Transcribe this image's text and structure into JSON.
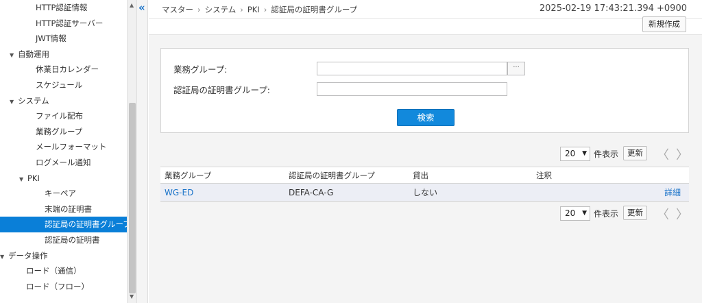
{
  "sidebar": {
    "items": [
      {
        "label": "HTTP認証情報",
        "indent": 52,
        "tri": "",
        "active": false
      },
      {
        "label": "HTTP認証サーバー",
        "indent": 52,
        "tri": "",
        "active": false
      },
      {
        "label": "JWT情報",
        "indent": 52,
        "tri": "",
        "active": false
      },
      {
        "label": "自動運用",
        "indent": 28,
        "tri": "▼",
        "active": false
      },
      {
        "label": "休業日カレンダー",
        "indent": 52,
        "tri": "",
        "active": false
      },
      {
        "label": "スケジュール",
        "indent": 52,
        "tri": "",
        "active": false
      },
      {
        "label": "システム",
        "indent": 28,
        "tri": "▼",
        "active": false
      },
      {
        "label": "ファイル配布",
        "indent": 52,
        "tri": "",
        "active": false
      },
      {
        "label": "業務グループ",
        "indent": 52,
        "tri": "",
        "active": false
      },
      {
        "label": "メールフォーマット",
        "indent": 52,
        "tri": "",
        "active": false
      },
      {
        "label": "ログメール通知",
        "indent": 52,
        "tri": "",
        "active": false
      },
      {
        "label": "PKI",
        "indent": 42,
        "tri": "▼",
        "active": false
      },
      {
        "label": "キーペア",
        "indent": 65,
        "tri": "",
        "active": false
      },
      {
        "label": "末端の証明書",
        "indent": 65,
        "tri": "",
        "active": false
      },
      {
        "label": "認証局の証明書グループ",
        "indent": 65,
        "tri": "",
        "active": true
      },
      {
        "label": "認証局の証明書",
        "indent": 65,
        "tri": "",
        "active": false
      },
      {
        "label": "データ操作",
        "indent": 12,
        "tri": "▼",
        "active": false
      },
      {
        "label": "ロード（通信）",
        "indent": 38,
        "tri": "",
        "active": false
      },
      {
        "label": "ロード（フロー）",
        "indent": 38,
        "tri": "",
        "active": false
      }
    ]
  },
  "collapse_glyph": "«",
  "breadcrumb": [
    "マスター",
    "システム",
    "PKI",
    "認証局の証明書グループ"
  ],
  "breadcrumb_sep": "›",
  "timestamp": "2025-02-19 17:43:21.394 +0900",
  "new_button": "新規作成",
  "search": {
    "group_label": "業務グループ:",
    "group_value": "",
    "ellipsis": "···",
    "cert_group_label": "認証局の証明書グループ:",
    "cert_group_value": "",
    "search_button": "検索"
  },
  "pager": {
    "page_size": "20",
    "per_page_label": "件表示",
    "refresh": "更新",
    "prev": "〈",
    "next": "〉"
  },
  "table": {
    "headers": [
      "業務グループ",
      "認証局の証明書グループ",
      "貸出",
      "注釈",
      ""
    ],
    "rows": [
      {
        "group": "WG-ED",
        "cert_group": "DEFA-CA-G",
        "lend": "しない",
        "note": "",
        "detail": "詳細"
      }
    ]
  },
  "colors": {
    "accent": "#0a7fd8",
    "link": "#1a73c9"
  }
}
